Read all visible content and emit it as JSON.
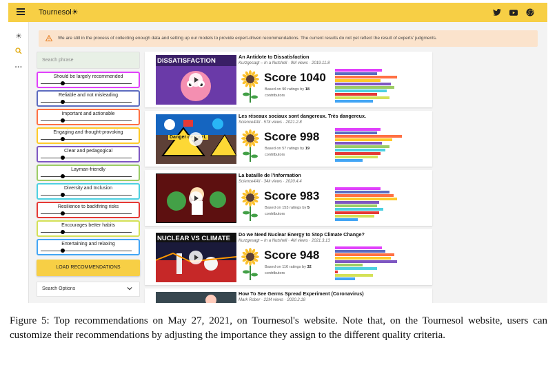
{
  "app": {
    "brand": "Tournesol",
    "brand_icon": "sun-icon",
    "top_icons": [
      "twitter-icon",
      "youtube-icon",
      "github-icon"
    ],
    "rail_icons": [
      "sun-icon",
      "search-icon",
      "more-icon"
    ],
    "accent": "#f7cf45",
    "banner": "We are still in the process of collecting enough data and setting up our models to provide expert-driven recommendations. The current results do not yet reflect the result of experts' judgments."
  },
  "filters": {
    "search_placeholder": "Search phrase",
    "criteria": [
      {
        "label": "Should be largely recommended",
        "color": "#e040fb"
      },
      {
        "label": "Reliable and not misleading",
        "color": "#5c6bc0"
      },
      {
        "label": "Important and actionable",
        "color": "#ff7043"
      },
      {
        "label": "Engaging and thought-provoking",
        "color": "#ffca28"
      },
      {
        "label": "Clear and pedagogical",
        "color": "#7e57c2"
      },
      {
        "label": "Layman-friendly",
        "color": "#9ccc65"
      },
      {
        "label": "Diversity and Inclusion",
        "color": "#4dd0e1"
      },
      {
        "label": "Resilience to backfiring risks",
        "color": "#e53935"
      },
      {
        "label": "Encourages better habits",
        "color": "#d4e157"
      },
      {
        "label": "Entertaining and relaxing",
        "color": "#42a5f5"
      }
    ],
    "load_button": "LOAD RECOMMENDATIONS",
    "search_options": "Search Options"
  },
  "videos": [
    {
      "title": "An Antidote to Dissatisfaction",
      "meta": "Kurzgesagt – In a Nutshell · 9M views · 2019.11.8",
      "thumb_text": "DISSATISFACTION",
      "score": "Score 1040",
      "based_prefix": "Based on 90 ratings by",
      "raters": "18",
      "based_suffix": "contributors",
      "bars": [
        0.62,
        0.55,
        0.82,
        0.6,
        0.74,
        0.78,
        0.68,
        0.55,
        0.72,
        0.5
      ]
    },
    {
      "title": "Les réseaux sociaux sont dangereux. Très dangereux.",
      "meta": "Science4All · 57k views · 2021.2.8",
      "thumb_text": "Danger de mort.",
      "score": "Score 998",
      "based_prefix": "Based on 57 ratings by",
      "raters": "19",
      "based_suffix": "contributors",
      "bars": [
        0.6,
        0.55,
        0.88,
        0.75,
        0.62,
        0.72,
        0.66,
        0.6,
        0.56,
        0.36
      ]
    },
    {
      "title": "La bataille de l'information",
      "meta": "Science4All · 34k views · 2020.4.4",
      "thumb_text": "",
      "score": "Score 983",
      "based_prefix": "Based on 153 ratings by",
      "raters": "5",
      "based_suffix": "contributors",
      "bars": [
        0.6,
        0.72,
        0.77,
        0.82,
        0.58,
        0.55,
        0.64,
        0.58,
        0.52,
        0.3
      ]
    },
    {
      "title": "Do we Need Nuclear Energy to Stop Climate Change?",
      "meta": "Kurzgesagt – In a Nutshell · 4M views · 2021.3.13",
      "thumb_text": "NUCLEAR VS CLIMATE",
      "score": "Score 948",
      "based_prefix": "Based on 116 ratings by",
      "raters": "32",
      "based_suffix": "contributors",
      "bars": [
        0.62,
        0.66,
        0.78,
        0.74,
        0.82,
        0.36,
        0.55,
        0.04,
        0.5,
        0.26
      ]
    },
    {
      "title": "How To See Germs Spread Experiment (Coronavirus)",
      "meta": "Mark Rober · 22M views · 2020.2.18",
      "thumb_text": "",
      "score": "",
      "based_prefix": "",
      "raters": "",
      "based_suffix": "",
      "bars": []
    }
  ],
  "caption": "Figure 5: Top recommendations on May 27, 2021, on Tournesol's website. Note that, on the Tournesol website, users can customize their recommendations by adjusting the importance they assign to the different quality criteria."
}
